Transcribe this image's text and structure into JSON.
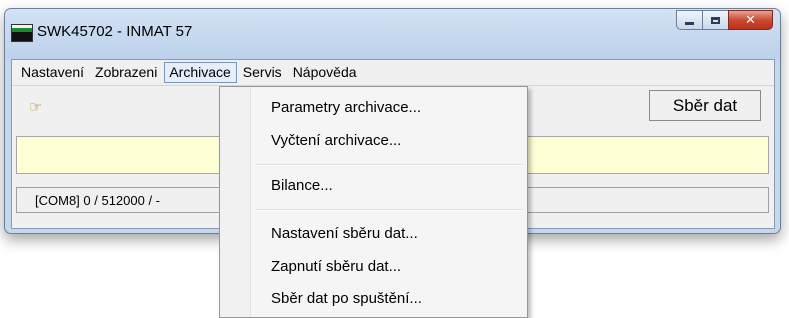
{
  "window": {
    "title": "SWK45702 - INMAT 57",
    "icon": "app-icon",
    "caption_buttons": [
      "minimize-icon",
      "maximize-icon",
      "close-icon"
    ]
  },
  "menubar": {
    "items": [
      {
        "label": "Nastavení"
      },
      {
        "label": "Zobrazeni"
      },
      {
        "label": "Archivace",
        "active": true
      },
      {
        "label": "Servis"
      },
      {
        "label": "Nápověda"
      }
    ]
  },
  "toolbar": {
    "icon": "pointing-hand-icon",
    "sber_button": "Sběr dat"
  },
  "status": {
    "text": "[COM8]  0 / 512000 / -"
  },
  "dropdown": {
    "items": [
      {
        "label": "Parametry archivace..."
      },
      {
        "label": "Vyčtení archivace..."
      },
      {
        "label": "Bilance..."
      },
      {
        "label": "Nastavení sběru dat..."
      },
      {
        "label": "Zapnutí sběru dat..."
      },
      {
        "label": "Sběr dat po spuštění..."
      }
    ]
  },
  "colors": {
    "info_bar": "#ffffd6",
    "close_button": "#c94a34",
    "window_frame": "#c5d7ee"
  }
}
